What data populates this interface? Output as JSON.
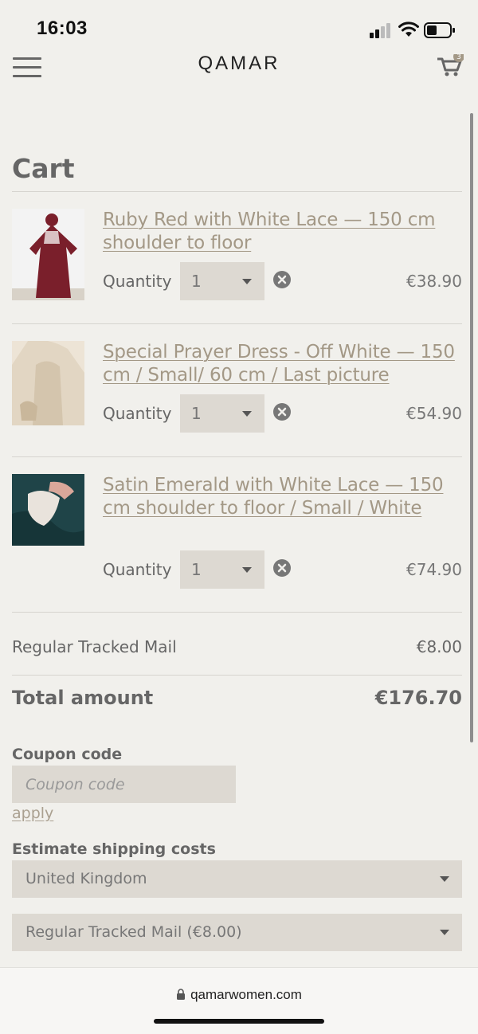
{
  "status_bar": {
    "time": "16:03"
  },
  "header": {
    "logo": "QAMAR",
    "cart_count": "3"
  },
  "page": {
    "title": "Cart"
  },
  "cart": {
    "quantity_label": "Quantity",
    "items": [
      {
        "title": "Ruby Red with White Lace — 150 cm shoulder to floor",
        "quantity": "1",
        "price": "€38.90",
        "thumb_color": "#7a1f2b"
      },
      {
        "title": "Special Prayer Dress - Off White — 150 cm / Small/ 60 cm / Last picture",
        "quantity": "1",
        "price": "€54.90",
        "thumb_color": "#e6dccb"
      },
      {
        "title": "Satin Emerald with White Lace — 150 cm shoulder to floor / Small / White",
        "quantity": "1",
        "price": "€74.90",
        "thumb_color": "#1f4448"
      }
    ]
  },
  "summary": {
    "shipping_label": "Regular Tracked Mail",
    "shipping_value": "€8.00",
    "total_label": "Total amount",
    "total_value": "€176.70"
  },
  "coupon": {
    "label": "Coupon code",
    "placeholder": "Coupon code",
    "apply_label": "apply"
  },
  "shipping_estimate": {
    "label": "Estimate shipping costs",
    "country": "United Kingdom",
    "method": "Regular Tracked Mail (€8.00)"
  },
  "browser": {
    "url": "qamarwomen.com"
  },
  "colors": {
    "background": "#f1f0ec",
    "link": "#a39886",
    "field": "#ddd9d2",
    "text": "#666666"
  }
}
